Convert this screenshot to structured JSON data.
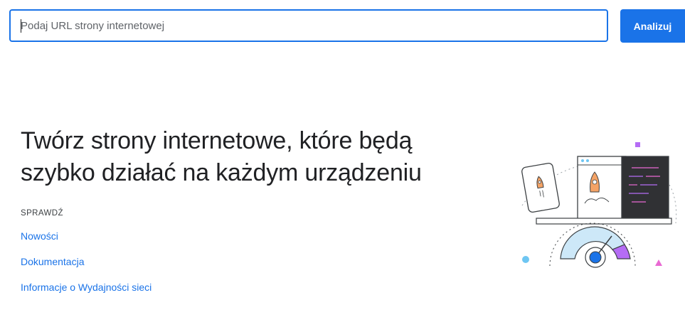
{
  "search": {
    "placeholder": "Podaj URL strony internetowej",
    "value": "",
    "button_label": "Analizuj"
  },
  "hero": {
    "headline": "Twórz strony internetowe, które będą szybko działać na każdym urządzeniu"
  },
  "check": {
    "label": "SPRAWDŹ",
    "links": [
      {
        "label": "Nowości"
      },
      {
        "label": "Dokumentacja"
      },
      {
        "label": "Informacje o Wydajności sieci"
      }
    ]
  },
  "colors": {
    "accent": "#1a73e8",
    "headline": "#202124",
    "gauge_light_blue": "#cde8f8",
    "gauge_purple": "#b56cf5",
    "dark_panel": "#303134",
    "rocket_orange": "#f4a366",
    "pink": "#e96ad3",
    "light_blue_dot": "#6ec6f2"
  },
  "illustration": {
    "icons": [
      "phone-rocket-icon",
      "browser-rocket-icon",
      "code-panel-icon",
      "speed-gauge-icon"
    ]
  }
}
